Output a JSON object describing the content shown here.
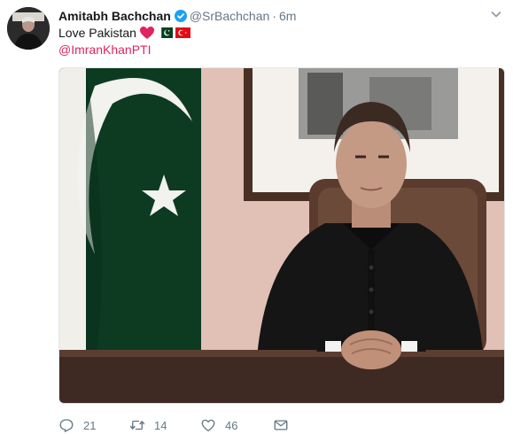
{
  "tweet": {
    "author_name": "Amitabh Bachchan",
    "handle": "@SrBachchan",
    "separator": "·",
    "time": "6m",
    "text": "Love Pakistan",
    "mention": "@ImranKhanPTI",
    "verified": true
  },
  "icons": {
    "verified": "verified-badge-icon",
    "heart": "red-heart-emoji",
    "flag_1": "pakistan-flag-emoji",
    "flag_2": "turkey-flag-emoji",
    "caret": "chevron-down-icon",
    "reply": "reply-icon",
    "retweet": "retweet-icon",
    "like": "like-icon",
    "dm": "envelope-icon"
  },
  "actions": {
    "reply_count": "21",
    "retweet_count": "14",
    "like_count": "46"
  },
  "colors": {
    "text": "#14171a",
    "secondary": "#657786",
    "mention": "#e0245e",
    "verified": "#1da1f2",
    "heart": "#e0245e"
  }
}
